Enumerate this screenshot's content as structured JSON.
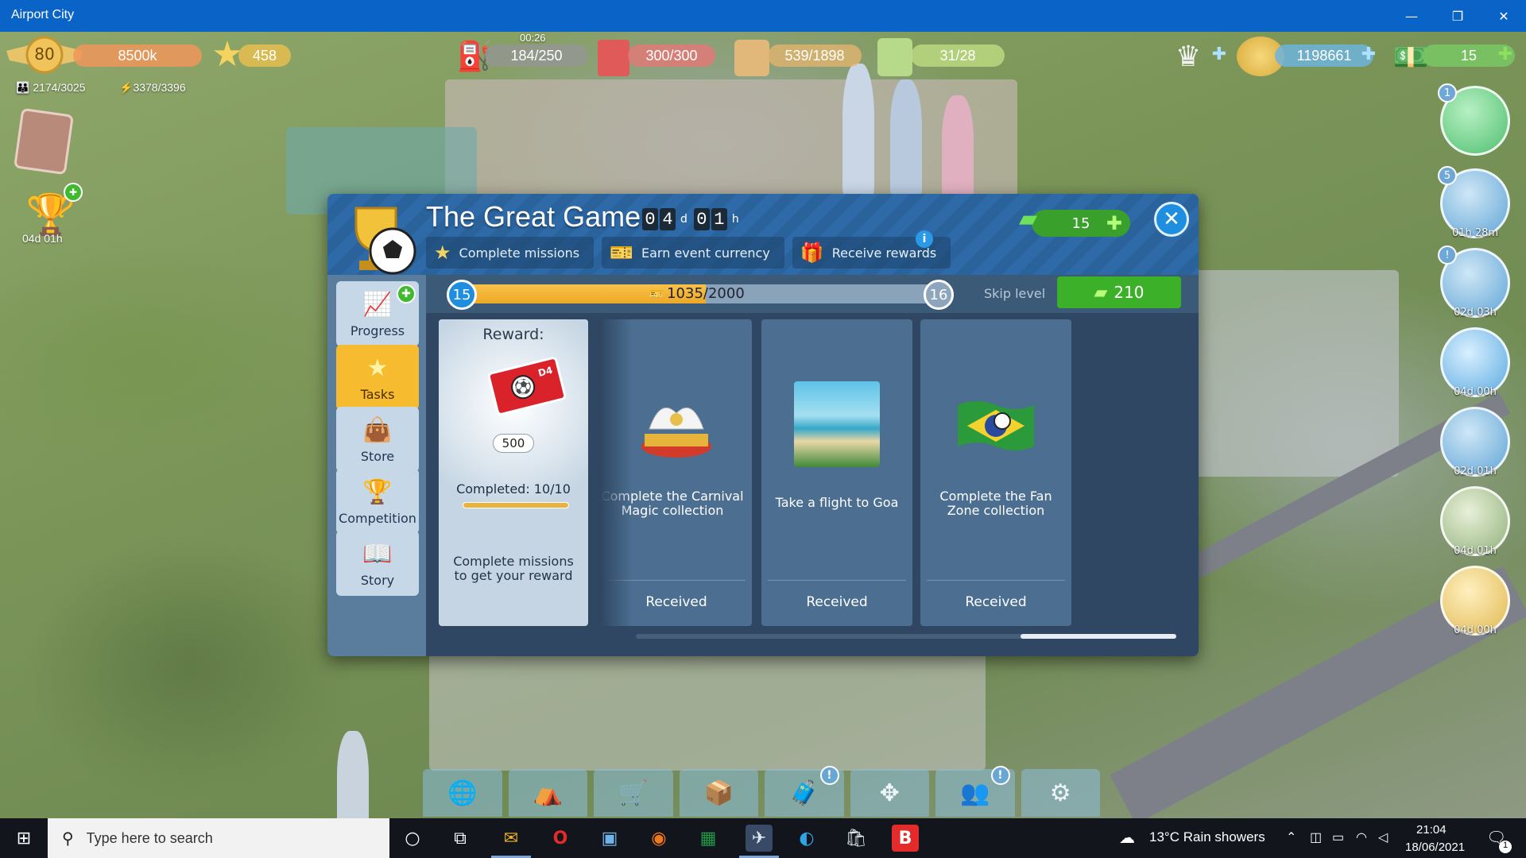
{
  "window": {
    "title": "Airport City",
    "minimize": "—",
    "maximize": "❐",
    "close": "✕"
  },
  "hud": {
    "level": "80",
    "money_k": "8500k",
    "stars": "458",
    "fuel_timer": "00:26",
    "fuel": "184/250",
    "cargo": "300/300",
    "passengers": "539/1898",
    "staff": "31/28",
    "population": "2174/3025",
    "energy": "3378/3396",
    "coins": "1198661",
    "bills": "15",
    "event_timer": "04d 01h"
  },
  "side_timers": [
    {
      "badge": "1",
      "timer": ""
    },
    {
      "badge": "5",
      "timer": "01h 28m"
    },
    {
      "badge": "!",
      "timer": "02d 03h"
    },
    {
      "badge": "",
      "timer": "04d 00h"
    },
    {
      "badge": "",
      "timer": "02d 01h"
    },
    {
      "badge": "",
      "timer": "04d 01h"
    },
    {
      "badge": "",
      "timer": "04d 00h"
    }
  ],
  "dialog": {
    "title": "The Great Game",
    "timer": {
      "d1": "0",
      "d2": "4",
      "d_unit": "d",
      "h1": "0",
      "h2": "1",
      "h_unit": "h"
    },
    "steps": [
      "Complete missions",
      "Earn event currency",
      "Receive rewards"
    ],
    "info": "i",
    "currency": "15",
    "close_label": "✕",
    "sidebar": [
      "Progress",
      "Tasks",
      "Store",
      "Competition",
      "Story"
    ],
    "progress": {
      "current_level": "15",
      "next_level": "16",
      "value_text": "1035/2000",
      "fraction": 0.5175,
      "skip_label": "Skip level",
      "skip_cost": "210"
    },
    "reward": {
      "label": "Reward:",
      "ticket_code": "D4",
      "amount": "500",
      "completed": "Completed: 10/10",
      "completed_fraction": 1.0,
      "description": "Complete missions to get your reward"
    },
    "tasks": [
      {
        "text": "Complete the Carnival Magic collection",
        "status": "Received"
      },
      {
        "text": "Take a flight to Goa",
        "status": "Received"
      },
      {
        "text": "Complete the Fan Zone collection",
        "status": "Received"
      }
    ]
  },
  "taskbar": {
    "search_placeholder": "Type here to search",
    "weather": "13°C  Rain showers",
    "time": "21:04",
    "date": "18/06/2021",
    "notifications": "1"
  }
}
